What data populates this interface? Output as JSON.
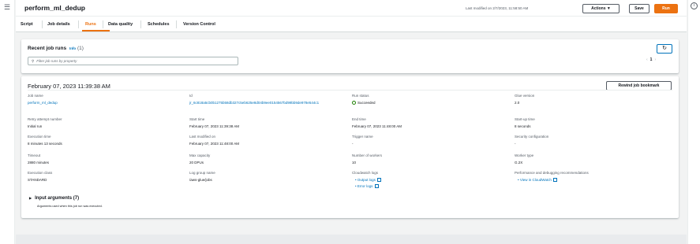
{
  "header": {
    "job_title": "perform_ml_dedup",
    "last_modified": "Last modified on 2/7/2023, 11:58:50 AM",
    "actions_label": "Actions ▼",
    "save_label": "Save",
    "run_label": "Run"
  },
  "tabs": [
    "Script",
    "Job details",
    "Runs",
    "Data quality",
    "Schedules",
    "Version Control"
  ],
  "recent_runs": {
    "title": "Recent job runs",
    "info": "Info",
    "count": "(1)",
    "filter_placeholder": "Filter job runs by property",
    "page": "1"
  },
  "run": {
    "date": "February 07, 2023 11:39:38 AM",
    "bookmark_label": "Rewind job bookmark",
    "fields": {
      "job_name_label": "Job name",
      "job_name": "perform_ml_dedup",
      "id_label": "Id",
      "id": "jr_6c818a5cb0b1275b58db327c5eb625e8d04b9ee0154567bd99bb9de978e544c1",
      "run_status_label": "Run status",
      "run_status": "Succeeded",
      "glue_version_label": "Glue version",
      "glue_version": "2.0",
      "retry_label": "Retry attempt number",
      "retry": "Initial run",
      "start_label": "Start time",
      "start": "February 07, 2023 11:39:38 AM",
      "end_label": "End time",
      "end": "February 07, 2023 11:48:00 AM",
      "startup_label": "Start-up time",
      "startup": "8 seconds",
      "exec_time_label": "Execution time",
      "exec_time": "8 minutes 13 seconds",
      "lastmod_label": "Last modified on",
      "lastmod": "February 07, 2023 11:48:00 AM",
      "trigger_label": "Trigger name",
      "trigger": "-",
      "security_label": "Security configuration",
      "security": "-",
      "timeout_label": "Timeout",
      "timeout": "2880 minutes",
      "maxcap_label": "Max capacity",
      "maxcap": "20 DPUs",
      "workers_label": "Number of workers",
      "workers": "10",
      "worker_type_label": "Worker type",
      "worker_type": "G.2X",
      "exec_class_label": "Execution class",
      "exec_class": "STANDARD",
      "loggroup_label": "Log group name",
      "loggroup": "/aws-glue/jobs",
      "cwlogs_label": "Cloudwatch logs",
      "output_logs": "Output logs",
      "error_logs": "Error logs",
      "perf_label": "Performance and debugging recommendations",
      "perf_link": "View in CloudWatch"
    },
    "input_args_title": "Input arguments (7)",
    "input_args_sub": "Arguments used when this job run was executed."
  }
}
